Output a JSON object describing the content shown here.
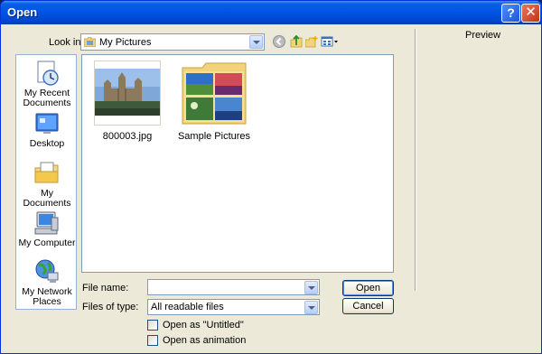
{
  "window": {
    "title": "Open",
    "help_glyph": "?",
    "close_glyph": "✕"
  },
  "lookin": {
    "label": "Look in:",
    "value": "My Pictures"
  },
  "toolbar": {
    "back_icon": "back-icon",
    "up_icon": "up-folder-icon",
    "new_folder_icon": "new-folder-icon",
    "views_icon": "views-menu-icon"
  },
  "places": [
    {
      "label1": "My Recent",
      "label2": "Documents",
      "icon": "recent-documents-icon"
    },
    {
      "label1": "Desktop",
      "label2": "",
      "icon": "desktop-icon"
    },
    {
      "label1": "My Documents",
      "label2": "",
      "icon": "my-documents-icon"
    },
    {
      "label1": "My Computer",
      "label2": "",
      "icon": "my-computer-icon"
    },
    {
      "label1": "My Network",
      "label2": "Places",
      "icon": "network-places-icon"
    }
  ],
  "files": [
    {
      "name": "800003.jpg",
      "type": "image"
    },
    {
      "name": "Sample Pictures",
      "type": "folder"
    }
  ],
  "filename": {
    "label": "File name:",
    "value": ""
  },
  "filetype": {
    "label": "Files of type:",
    "value": "All readable files"
  },
  "buttons": {
    "open": "Open",
    "cancel": "Cancel"
  },
  "options": [
    {
      "label": "Open as \"Untitled\"",
      "checked": false
    },
    {
      "label": "Open as animation",
      "checked": false
    }
  ],
  "preview": {
    "label": "Preview"
  },
  "colors": {
    "titlebar": "#0054e3",
    "face": "#ece9d8",
    "border": "#7f9db9"
  }
}
